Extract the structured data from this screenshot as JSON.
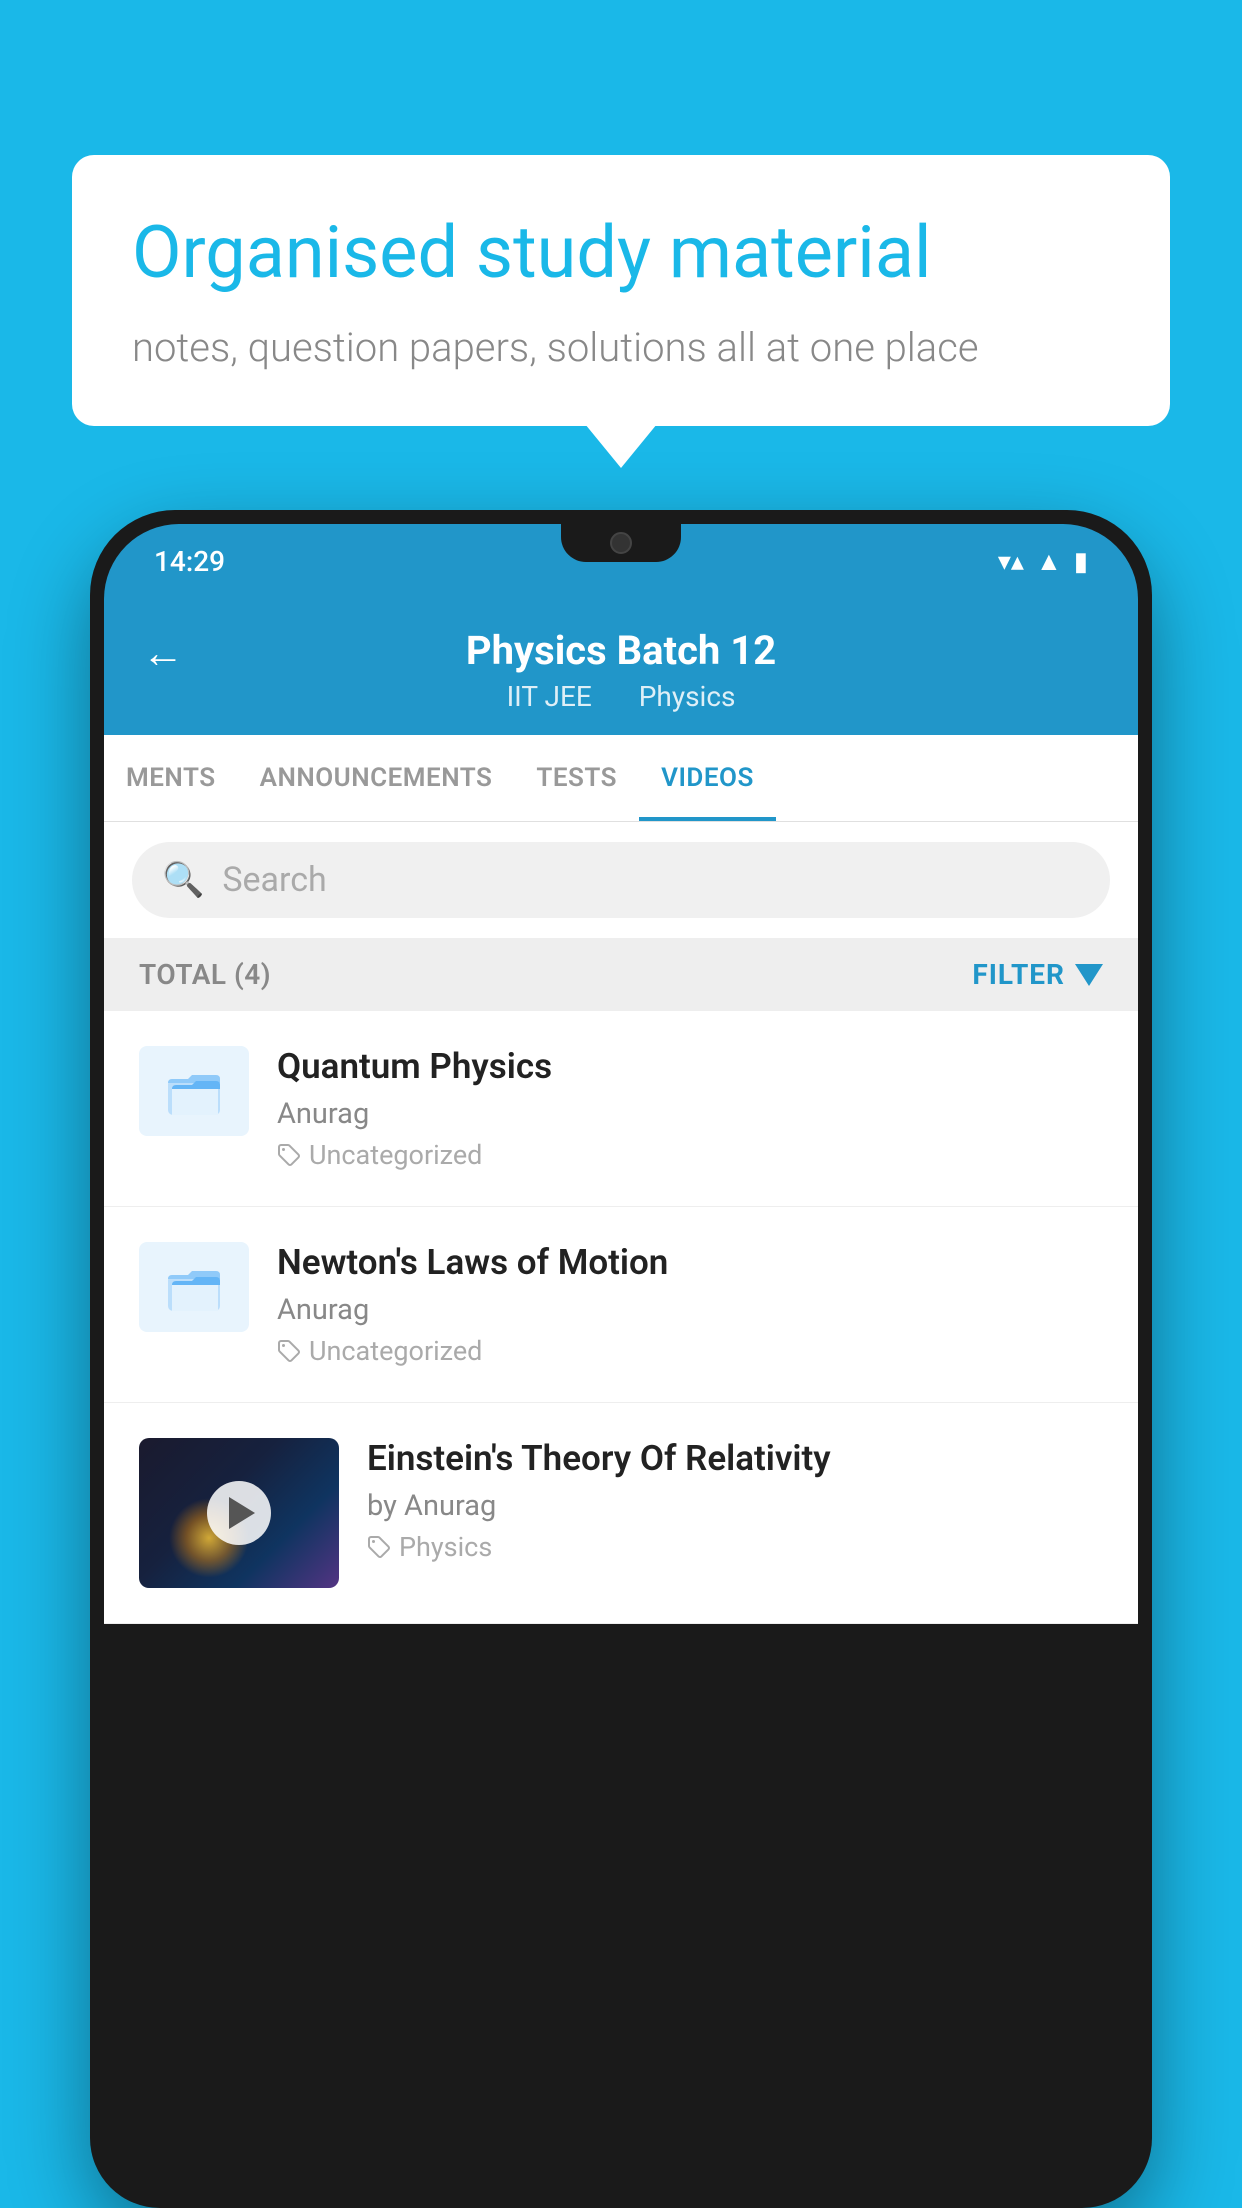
{
  "background_color": "#1ab8e8",
  "speech_bubble": {
    "heading": "Organised study material",
    "subtext": "notes, question papers, solutions all at one place"
  },
  "phone": {
    "status_bar": {
      "time": "14:29",
      "wifi": "▼▲",
      "signal": "▲",
      "battery": "▮"
    },
    "header": {
      "back_label": "←",
      "title": "Physics Batch 12",
      "subtitle_part1": "IIT JEE",
      "subtitle_part2": "Physics"
    },
    "tabs": [
      {
        "label": "MENTS",
        "active": false
      },
      {
        "label": "ANNOUNCEMENTS",
        "active": false
      },
      {
        "label": "TESTS",
        "active": false
      },
      {
        "label": "VIDEOS",
        "active": true
      }
    ],
    "search": {
      "placeholder": "Search"
    },
    "filter_bar": {
      "total_label": "TOTAL (4)",
      "filter_label": "FILTER"
    },
    "videos": [
      {
        "id": 1,
        "title": "Quantum Physics",
        "author": "Anurag",
        "tag": "Uncategorized",
        "has_thumbnail": false
      },
      {
        "id": 2,
        "title": "Newton's Laws of Motion",
        "author": "Anurag",
        "tag": "Uncategorized",
        "has_thumbnail": false
      },
      {
        "id": 3,
        "title": "Einstein's Theory Of Relativity",
        "author": "by Anurag",
        "tag": "Physics",
        "has_thumbnail": true
      }
    ]
  }
}
